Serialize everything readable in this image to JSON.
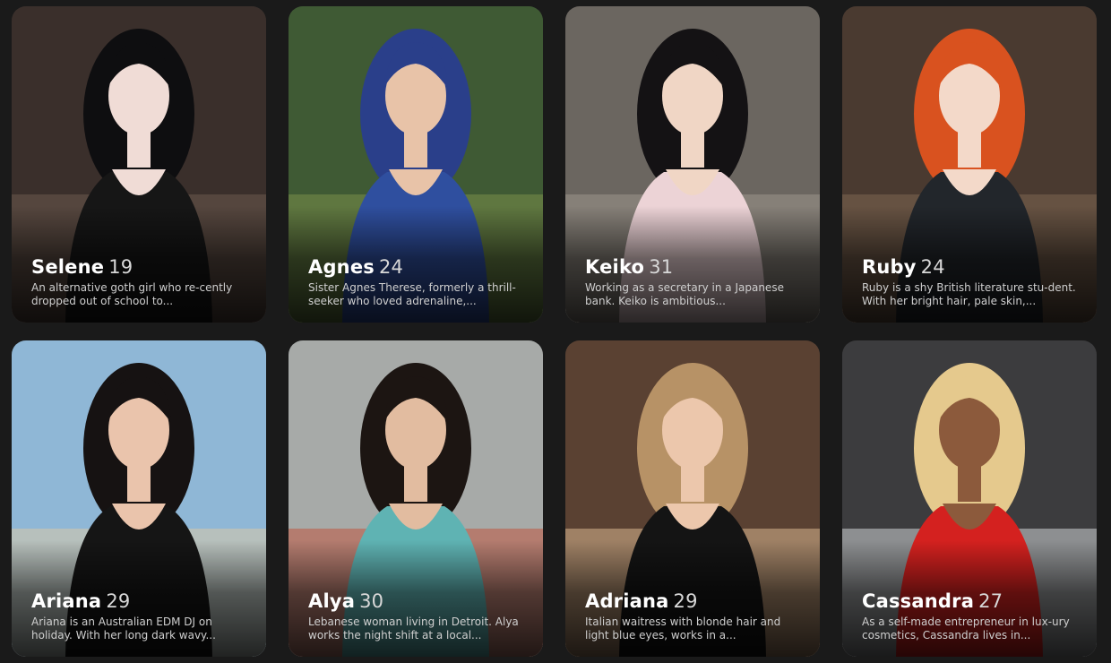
{
  "profiles": [
    {
      "name": "Selene",
      "age": "19",
      "description": "An alternative goth girl who re-cently dropped out of school to...",
      "bg": "#3a2f2b",
      "accent": "#6b5a4e",
      "figure": "#161616",
      "hair": "#0e0e10",
      "skin": "#f0dcd6"
    },
    {
      "name": "Agnes",
      "age": "24",
      "description": "Sister Agnes Therese, formerly a thrill-seeker who loved adrenaline,...",
      "bg": "#3f5a34",
      "accent": "#7a8f4a",
      "figure": "#2f4f9f",
      "hair": "#2a3f8a",
      "skin": "#e8c3a8"
    },
    {
      "name": "Keiko",
      "age": "31",
      "description": "Working as a secretary in a Japanese bank. Keiko is ambitious...",
      "bg": "#6b6660",
      "accent": "#9c958c",
      "figure": "#ecd3d6",
      "hair": "#141214",
      "skin": "#f0d6c5"
    },
    {
      "name": "Ruby",
      "age": "24",
      "description": "Ruby is a shy British literature stu-dent. With her bright hair, pale skin,...",
      "bg": "#4a3a30",
      "accent": "#7d6652",
      "figure": "#22262b",
      "hair": "#d9521f",
      "skin": "#f3d9c9"
    },
    {
      "name": "Ariana",
      "age": "29",
      "description": "Ariana is an Australian EDM DJ on holiday. With her long dark wavy...",
      "bg": "#8fb7d6",
      "accent": "#d8c8a8",
      "figure": "#151515",
      "hair": "#161212",
      "skin": "#eac4ac"
    },
    {
      "name": "Alya",
      "age": "30",
      "description": "Lebanese woman living in Detroit. Alya works the night shift at a local...",
      "bg": "#a7aaa8",
      "accent": "#c0563f",
      "figure": "#5fb3b3",
      "hair": "#1c1512",
      "skin": "#e2bca0"
    },
    {
      "name": "Adriana",
      "age": "29",
      "description": "Italian waitress with blonde hair and light blue eyes, works in a...",
      "bg": "#5a4132",
      "accent": "#d9b690",
      "figure": "#141414",
      "hair": "#b79266",
      "skin": "#ecc7ac"
    },
    {
      "name": "Cassandra",
      "age": "27",
      "description": "As a self-made entrepreneur in lux-ury cosmetics, Cassandra lives in...",
      "bg": "#3c3c3e",
      "accent": "#cfd3d6",
      "figure": "#d4211f",
      "hair": "#e5c98d",
      "skin": "#8c5a3c"
    }
  ]
}
